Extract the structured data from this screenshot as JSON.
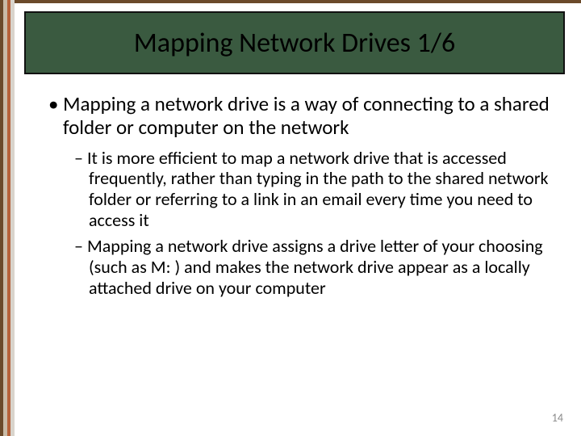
{
  "slide": {
    "title": "Mapping Network Drives 1/6",
    "bullets": {
      "main": "Mapping a network drive is a way of connecting to a shared folder or computer on the network",
      "sub1": "It is more efficient to map a network drive that is accessed frequently, rather than typing in the path to the shared network folder or referring to a link in an email every time you need to access it",
      "sub2": "Mapping a network drive assigns a drive letter of your choosing (such as M: ) and makes the network drive appear as a locally attached drive on your computer"
    },
    "page_number": "14"
  }
}
